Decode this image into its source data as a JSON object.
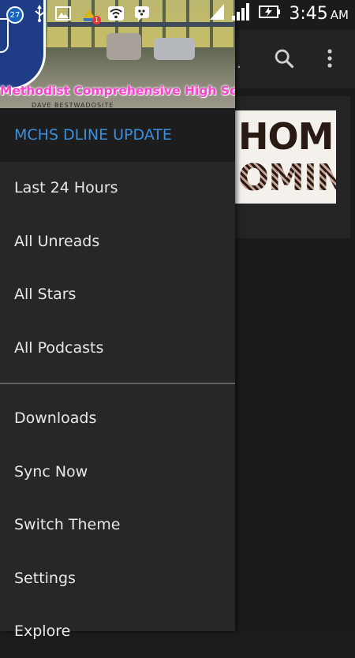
{
  "status_bar": {
    "notification_count": "27",
    "badge_count": "1",
    "time": "3:45",
    "ampm": "AM"
  },
  "header": {
    "school_name": "Methodist Comprehensive High School",
    "subtitle": "DAVE BESTWADOSITE"
  },
  "drawer": {
    "items": [
      {
        "label": "MCHS DLINE UPDATE"
      },
      {
        "label": "Last 24 Hours"
      },
      {
        "label": "All Unreads"
      },
      {
        "label": "All Stars"
      },
      {
        "label": "All Podcasts"
      },
      {
        "label": "Downloads"
      },
      {
        "label": "Sync Now"
      },
      {
        "label": "Switch Theme"
      },
      {
        "label": "Settings"
      },
      {
        "label": "Explore"
      }
    ]
  },
  "background": {
    "toolbar_ellipsis": ".",
    "card_line1": "HOME",
    "card_line2": "OMIN"
  },
  "colors": {
    "accent": "#3b8fe0",
    "drawer_bg": "#272727",
    "school_name": "#ff3fcf"
  }
}
